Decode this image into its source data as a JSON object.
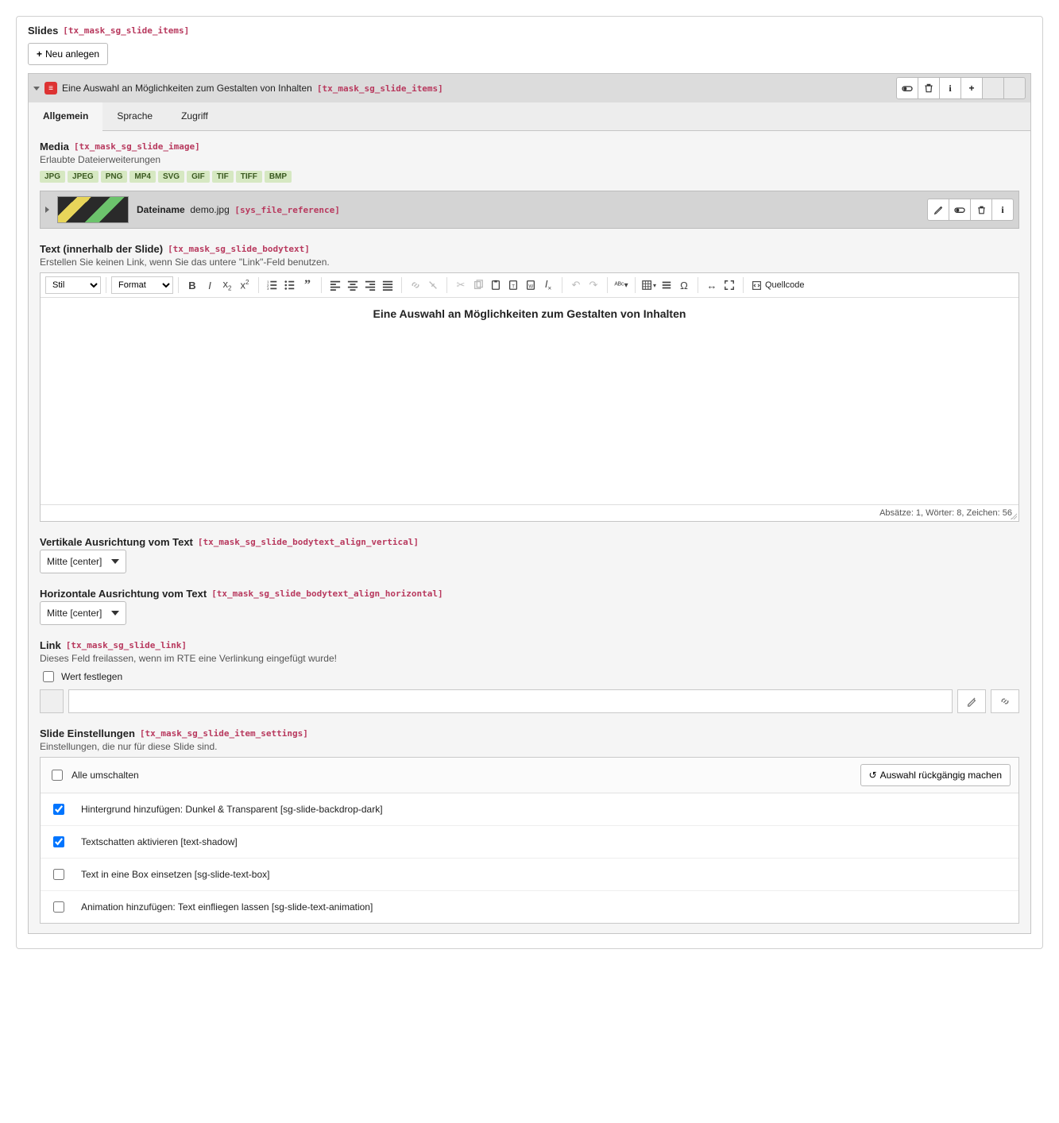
{
  "slides": {
    "title": "Slides",
    "techname": "[tx_mask_sg_slide_items]",
    "create_btn": "Neu anlegen"
  },
  "item": {
    "title": "Eine Auswahl an Möglichkeiten zum Gestalten von Inhalten",
    "techname": "[tx_mask_sg_slide_items]",
    "tabs": {
      "general": "Allgemein",
      "language": "Sprache",
      "access": "Zugriff"
    }
  },
  "media": {
    "title": "Media",
    "techname": "[tx_mask_sg_slide_image]",
    "allowed_label": "Erlaubte Dateierweiterungen",
    "ext": [
      "JPG",
      "JPEG",
      "PNG",
      "MP4",
      "SVG",
      "GIF",
      "TIF",
      "TIFF",
      "BMP"
    ],
    "file": {
      "label": "Dateiname",
      "name": "demo.jpg",
      "tech": "[sys_file_reference]"
    }
  },
  "text": {
    "title": "Text (innerhalb der Slide)",
    "techname": "[tx_mask_sg_slide_bodytext]",
    "hint": "Erstellen Sie keinen Link, wenn Sie das untere \"Link\"-Feld benutzen.",
    "toolbar": {
      "style": "Stil",
      "format": "Format",
      "source": "Quellcode"
    },
    "content_heading": "Eine Auswahl an Möglichkeiten zum Gestalten von Inhalten",
    "status": "Absätze: 1, Wörter: 8, Zeichen: 56"
  },
  "valign": {
    "title": "Vertikale Ausrichtung vom Text",
    "techname": "[tx_mask_sg_slide_bodytext_align_vertical]",
    "value": "Mitte [center]"
  },
  "halign": {
    "title": "Horizontale Ausrichtung vom Text",
    "techname": "[tx_mask_sg_slide_bodytext_align_horizontal]",
    "value": "Mitte [center]"
  },
  "link": {
    "title": "Link",
    "techname": "[tx_mask_sg_slide_link]",
    "hint": "Dieses Feld freilassen, wenn im RTE eine Verlinkung eingefügt wurde!",
    "set_value": "Wert festlegen"
  },
  "settings": {
    "title": "Slide Einstellungen",
    "techname": "[tx_mask_sg_slide_item_settings]",
    "hint": "Einstellungen, die nur für diese Slide sind.",
    "toggle_all": "Alle umschalten",
    "undo": "Auswahl rückgängig machen",
    "options": [
      {
        "checked": true,
        "label": "Hintergrund hinzufügen: Dunkel & Transparent [sg-slide-backdrop-dark]"
      },
      {
        "checked": true,
        "label": "Textschatten aktivieren [text-shadow]"
      },
      {
        "checked": false,
        "label": "Text in eine Box einsetzen [sg-slide-text-box]"
      },
      {
        "checked": false,
        "label": "Animation hinzufügen: Text einfliegen lassen [sg-slide-text-animation]"
      }
    ]
  }
}
